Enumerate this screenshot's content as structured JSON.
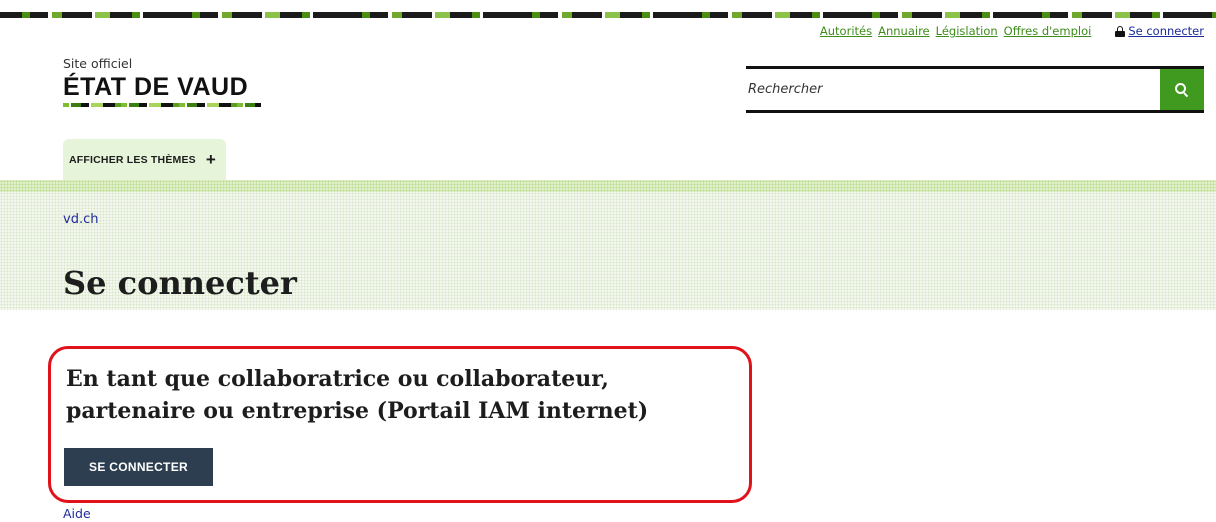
{
  "utility_nav": {
    "links": [
      "Autorités",
      "Annuaire",
      "Législation",
      "Offres d'emploi"
    ],
    "login_label": "Se connecter"
  },
  "logo": {
    "subtitle": "Site officiel",
    "title": "ÉTAT DE VAUD"
  },
  "search": {
    "placeholder": "Rechercher",
    "button_icon": "search-icon",
    "button_color": "#3f9a1f"
  },
  "theme_tab": {
    "label": "AFFICHER LES THÈMES",
    "icon": "plus-icon"
  },
  "breadcrumb": {
    "label": "vd.ch"
  },
  "page": {
    "title": "Se connecter"
  },
  "section": {
    "title_line1": "En tant que collaboratrice ou collaborateur,",
    "title_line2": "partenaire ou entreprise (Portail IAM internet)",
    "button_label": "SE CONNECTER",
    "highlight_color": "#e0121b"
  },
  "help_link": "Aide",
  "colors": {
    "link_green": "#3e8c1b",
    "link_blue": "#1e2a9b",
    "button_dark": "#2c3e50"
  }
}
